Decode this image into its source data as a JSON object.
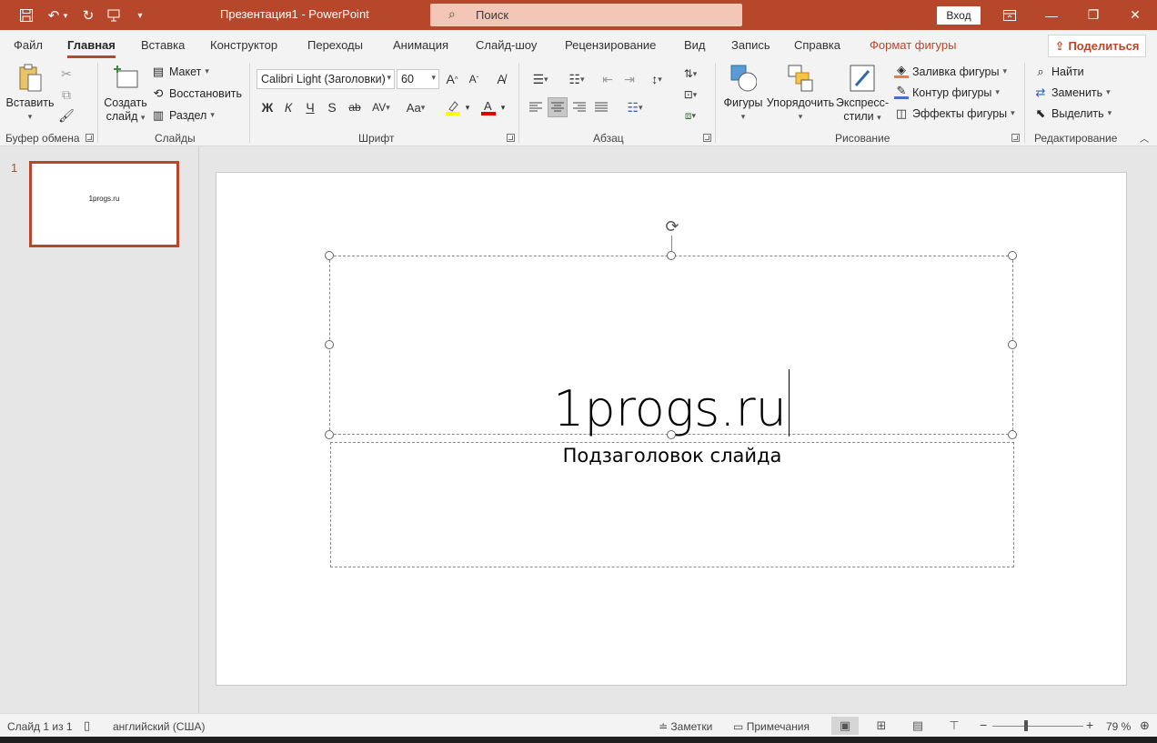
{
  "titlebar": {
    "doc_title": "Презентация1  -  PowerPoint",
    "search_label": "Поиск",
    "sign_in": "Вход"
  },
  "tabs": [
    {
      "label": "Файл"
    },
    {
      "label": "Главная"
    },
    {
      "label": "Вставка"
    },
    {
      "label": "Конструктор"
    },
    {
      "label": "Переходы"
    },
    {
      "label": "Анимация"
    },
    {
      "label": "Слайд-шоу"
    },
    {
      "label": "Рецензирование"
    },
    {
      "label": "Вид"
    },
    {
      "label": "Запись"
    },
    {
      "label": "Справка"
    },
    {
      "label": "Формат фигуры"
    }
  ],
  "share_label": "Поделиться",
  "ribbon": {
    "clipboard": {
      "paste": "Вставить",
      "group": "Буфер обмена"
    },
    "slides": {
      "new_slide_1": "Создать",
      "new_slide_2": "слайд",
      "layout": "Макет",
      "reset": "Восстановить",
      "section": "Раздел",
      "group": "Слайды"
    },
    "font": {
      "name": "Calibri Light (Заголовки)",
      "size": "60",
      "group": "Шрифт",
      "bold": "Ж",
      "italic": "К",
      "underline": "Ч",
      "shadow": "S",
      "strike": "ab"
    },
    "paragraph": {
      "group": "Абзац"
    },
    "drawing": {
      "shapes": "Фигуры",
      "arrange": "Упорядочить",
      "quick_1": "Экспресс-",
      "quick_2": "стили",
      "fill": "Заливка фигуры",
      "outline": "Контур фигуры",
      "effects": "Эффекты фигуры",
      "group": "Рисование"
    },
    "editing": {
      "find": "Найти",
      "replace": "Заменить",
      "select": "Выделить",
      "group": "Редактирование"
    }
  },
  "thumbnails": [
    {
      "number": "1",
      "text": "1progs.ru"
    }
  ],
  "slide": {
    "title": "1progs.ru",
    "subtitle": "Подзаголовок слайда"
  },
  "statusbar": {
    "slide_info": "Слайд 1 из 1",
    "language": "английский (США)",
    "notes": "Заметки",
    "comments": "Примечания",
    "zoom": "79 %"
  },
  "colors": {
    "accent": "#b7472a",
    "search_bg": "#f4c6b7"
  }
}
